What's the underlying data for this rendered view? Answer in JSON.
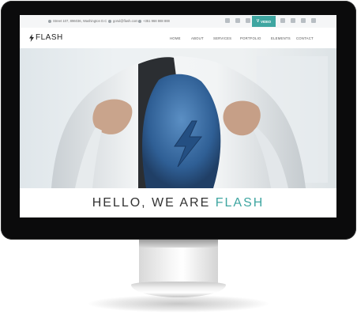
{
  "topbar": {
    "address": "Street 107, 896036, Washington D.C",
    "email": "gorul@flash.com",
    "phone": "+351 968 888 888",
    "video_label": "VIDEO",
    "social_icons": [
      "facebook-icon",
      "twitter-icon",
      "linkedin-icon",
      "vimeo-icon",
      "rss-icon",
      "dribbble-icon",
      "instagram-icon",
      "skype-icon"
    ]
  },
  "header": {
    "logo_text": "FLASH",
    "nav": [
      "HOME",
      "ABOUT",
      "SERVICES",
      "PORTFOLIO",
      "ELEMENTS",
      "CONTACT"
    ]
  },
  "hero": {
    "headline_prefix": "HELLO, WE ARE",
    "headline_accent": "FLASH"
  },
  "colors": {
    "accent": "#3fa6a1",
    "monitor_bezel": "#0b0b0c",
    "chest_blue": "#3a6fa7"
  }
}
